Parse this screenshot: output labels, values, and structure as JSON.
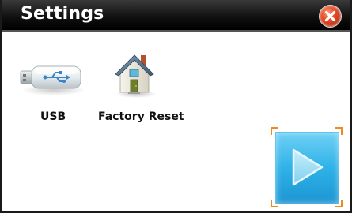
{
  "window": {
    "title": "Settings"
  },
  "icons": {
    "close": "close-icon",
    "usb": "usb-drive-icon",
    "factory_reset": "house-icon",
    "play": "play-icon"
  },
  "items": [
    {
      "label": "USB"
    },
    {
      "label": "Factory Reset"
    }
  ],
  "colors": {
    "titlebar": "#000000",
    "close": "#d9401d",
    "play_tile": "#2fb2e8",
    "selection_corners": "#f08a1c"
  }
}
